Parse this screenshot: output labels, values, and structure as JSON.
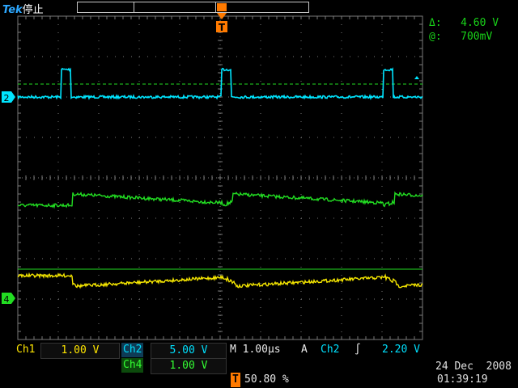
{
  "top": {
    "brand": "Tek",
    "acq_state": "停止",
    "trigger_position_marker": "T"
  },
  "cursor_readout": {
    "delta": "Δ:   4.60 V",
    "at": "@:   700mV"
  },
  "channel_markers": {
    "ch2": "2",
    "ch4": "4"
  },
  "bottom": {
    "ch1_label": "Ch1",
    "ch1_scale": "1.00 V",
    "ch2_label": "Ch2",
    "ch2_scale": "5.00 V",
    "ch4_label": "Ch4",
    "ch4_scale": "1.00 V",
    "timebase": "M 1.00µs",
    "trigger_mode": "A",
    "trigger_source": "Ch2",
    "trigger_slope": "∫",
    "trigger_level": "2.20 V",
    "trigger_pos_label": "T",
    "trigger_pos_value": "50.80 %",
    "date": "24 Dec  2008",
    "time": "01:39:19"
  },
  "colors": {
    "grid": "#7a7a7a",
    "ch1": "#f5e600",
    "ch2": "#00e5ff",
    "ch4": "#22dd22",
    "trigger": "#ff7a00"
  }
}
